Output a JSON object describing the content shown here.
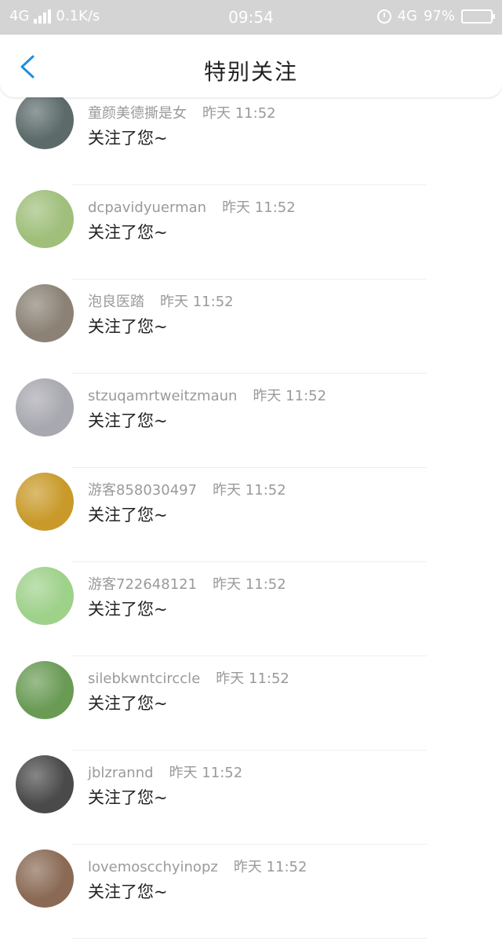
{
  "status_bar": {
    "network": "4G",
    "speed": "0.1K/s",
    "time": "09:54",
    "network_right": "4G",
    "battery": "97%"
  },
  "header": {
    "title": "特别关注"
  },
  "list": [
    {
      "name": "童颜美德撕是女",
      "time": "昨天 11:52",
      "message": "关注了您~",
      "avatar_color": "#5c6a6a"
    },
    {
      "name": "dcpavidyuerman",
      "time": "昨天 11:52",
      "message": "关注了您~",
      "avatar_color": "#9fbf7a"
    },
    {
      "name": "泡良医踏",
      "time": "昨天 11:52",
      "message": "关注了您~",
      "avatar_color": "#8b8275"
    },
    {
      "name": "stzuqamrtweitzmaun",
      "time": "昨天 11:52",
      "message": "关注了您~",
      "avatar_color": "#a8a8b0"
    },
    {
      "name": "游客858030497",
      "time": "昨天 11:52",
      "message": "关注了您~",
      "avatar_color": "#c99a2a"
    },
    {
      "name": "游客722648121",
      "time": "昨天 11:52",
      "message": "关注了您~",
      "avatar_color": "#9ed18a"
    },
    {
      "name": "silebkwntcirccle",
      "time": "昨天 11:52",
      "message": "关注了您~",
      "avatar_color": "#6a9b55"
    },
    {
      "name": "jblzrannd",
      "time": "昨天 11:52",
      "message": "关注了您~",
      "avatar_color": "#4a4a4a"
    },
    {
      "name": "lovemoscchyinopz",
      "time": "昨天 11:52",
      "message": "关注了您~",
      "avatar_color": "#8a6a55"
    }
  ]
}
